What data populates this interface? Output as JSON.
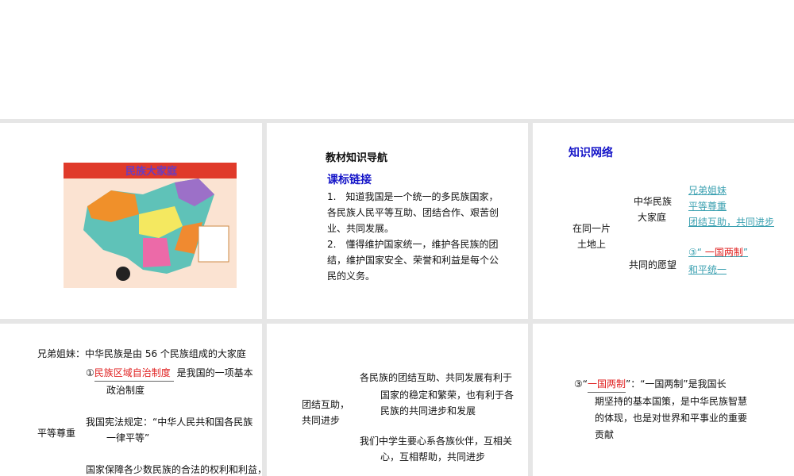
{
  "slide1": {
    "map_title": "民族大家庭"
  },
  "slide2": {
    "heading": "教材知识导航",
    "subheading": "课标链接",
    "lines": [
      "1.　知道我国是一个统一的多民族国家，",
      "各民族人民平等互助、团结合作、艰苦创",
      "业、共同发展。",
      "2.　懂得维护国家统一，维护各民族的团",
      "结，维护国家安全、荣誉和利益是每个公",
      "民的义务。"
    ]
  },
  "slide3": {
    "heading": "知识网络",
    "root": [
      "在同一片",
      "土地上"
    ],
    "branch1": [
      "中华民族",
      "大家庭"
    ],
    "branch2": "共同的愿望",
    "leaves1": [
      "兄弟姐妹",
      "平等尊重",
      "团结互助，共同进步"
    ],
    "leaf2_prefix": "③“",
    "leaf2_red": "一国两制",
    "leaf2_suffix": "”",
    "leaf3": "和平统一"
  },
  "slide4": {
    "label1": "兄弟姐妹：",
    "text1": "中华民族是由 56 个民族组成的大家庭",
    "num": "①",
    "red": "民族区域自治制度",
    "text2a": " 是我国的一项基本",
    "text2b": "政治制度",
    "label2": "平等尊重",
    "text3a": "我国宪法规定：“中华人民共和国各民族",
    "text3b": "一律平等”",
    "text4": "国家保障各少数民族的合法的权利和利益，"
  },
  "slide5": {
    "label": [
      "团结互助，",
      "共同进步"
    ],
    "p1": [
      "各民族的团结互助、共同发展有利于",
      "国家的稳定和繁荣，也有利于各",
      "民族的共同进步和发展"
    ],
    "p2": [
      "我们中学生要心系各族伙伴，互相关",
      "心，互相帮助，共同进步"
    ]
  },
  "slide6": {
    "prefix": "③“",
    "red": "一国两制",
    "mid": "”：“一国两制”是我国长",
    "lines": [
      "期坚持的基本国策，是中华民族智慧",
      "的体现，也是对世界和平事业的重要",
      "贡献"
    ]
  }
}
